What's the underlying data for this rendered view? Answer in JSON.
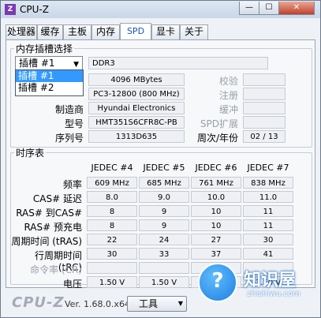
{
  "window": {
    "title": "CPU-Z",
    "icon_text": "Z",
    "minimize_glyph": "—",
    "maximize_glyph": "☐",
    "close_glyph": "✕"
  },
  "tabs": [
    {
      "label": "处理器"
    },
    {
      "label": "缓存"
    },
    {
      "label": "主板"
    },
    {
      "label": "内存"
    },
    {
      "label": "SPD"
    },
    {
      "label": "显卡"
    },
    {
      "label": "关于"
    }
  ],
  "active_tab": "SPD",
  "slot_section": {
    "legend": "内存插槽选择",
    "selected_slot": "插槽 #1",
    "dropdown_arrow": "▼",
    "options": [
      "插槽 #1",
      "插槽 #2"
    ],
    "memory_type": "DDR3",
    "module_size": "4096 MBytes",
    "max_bandwidth": "PC3-12800 (800 MHz)",
    "manufacturer_label": "制造商",
    "manufacturer": "Hyundai Electronics",
    "part_label": "型号",
    "part_number": "HMT351S6CFR8C-PB",
    "serial_label": "序列号",
    "serial_number": "1313D635",
    "correction_label": "校验",
    "registered_label": "注册",
    "buffered_label": "缓冲",
    "spd_ext_label": "SPD扩展",
    "week_year_label": "周次/年份",
    "week_year": "02 / 13"
  },
  "timings": {
    "legend": "时序表",
    "columns": [
      "JEDEC #4",
      "JEDEC #5",
      "JEDEC #6",
      "JEDEC #7"
    ],
    "rows": [
      {
        "label": "频率",
        "values": [
          "609 MHz",
          "685 MHz",
          "761 MHz",
          "838 MHz"
        ],
        "dim": false
      },
      {
        "label": "CAS# 延迟",
        "values": [
          "8.0",
          "9.0",
          "10.0",
          "11.0"
        ],
        "dim": false
      },
      {
        "label": "RAS# 到CAS#",
        "values": [
          "8",
          "9",
          "10",
          "11"
        ],
        "dim": false
      },
      {
        "label": "RAS# 预充电",
        "values": [
          "8",
          "9",
          "10",
          "11"
        ],
        "dim": false
      },
      {
        "label": "周期时间 (tRAS)",
        "values": [
          "22",
          "24",
          "27",
          "30"
        ],
        "dim": false
      },
      {
        "label": "行周期时间 (tRC)",
        "values": [
          "30",
          "33",
          "37",
          "41"
        ],
        "dim": false
      },
      {
        "label": "命令率 (CR)",
        "values": [
          "",
          "",
          "",
          ""
        ],
        "dim": true
      },
      {
        "label": "电压",
        "values": [
          "1.50 V",
          "1.50 V",
          "1.50 V",
          "1.50 V"
        ],
        "dim": false
      }
    ]
  },
  "footer": {
    "brand": "CPU-Z",
    "version": "Ver. 1.68.0.x64",
    "tools_label": "工具",
    "tools_arrow": "▼"
  },
  "watermark": {
    "icon_glyph": "?",
    "text": "知识屋",
    "subtext": "zhishiwu.com"
  }
}
